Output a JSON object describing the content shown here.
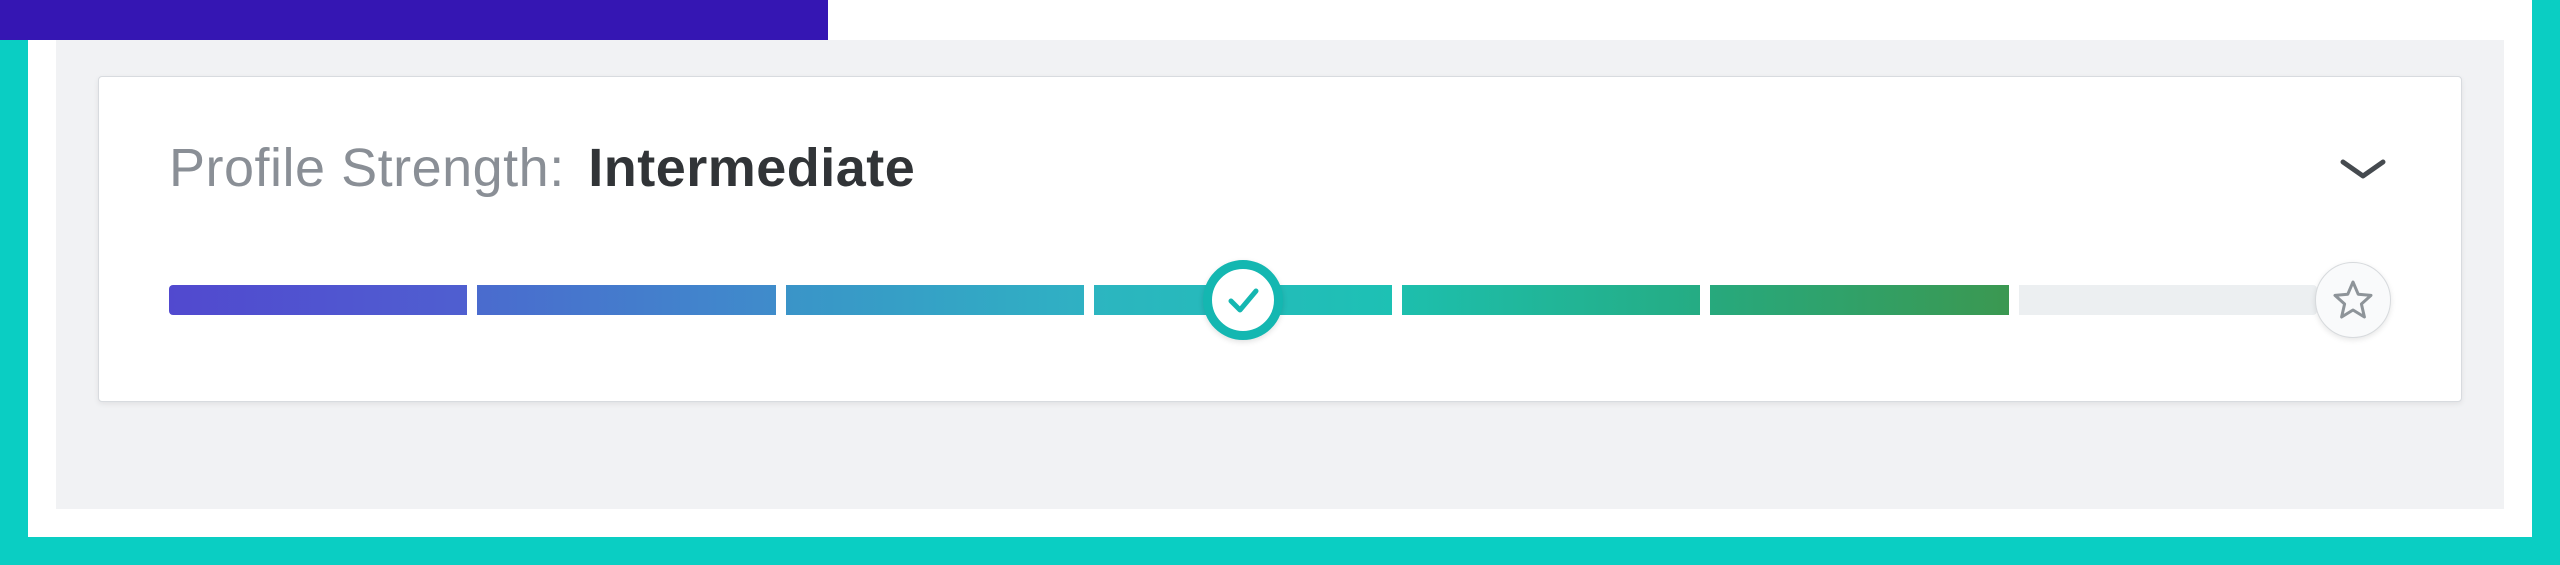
{
  "profile_strength": {
    "label": "Profile Strength:",
    "level": "Intermediate",
    "segments_total": 7,
    "segments_completed": 6,
    "check_position_fraction": 0.5,
    "colors": {
      "frame": "#0acec3",
      "accent_bar": "#3516b3",
      "check_ring": "#14b7b1",
      "gradient_start": "#5149cf",
      "gradient_end": "#3b9851",
      "empty_segment": "#eceff1"
    },
    "icons": {
      "expand": "chevron-down-icon",
      "complete": "star-icon",
      "current": "check-icon"
    }
  }
}
